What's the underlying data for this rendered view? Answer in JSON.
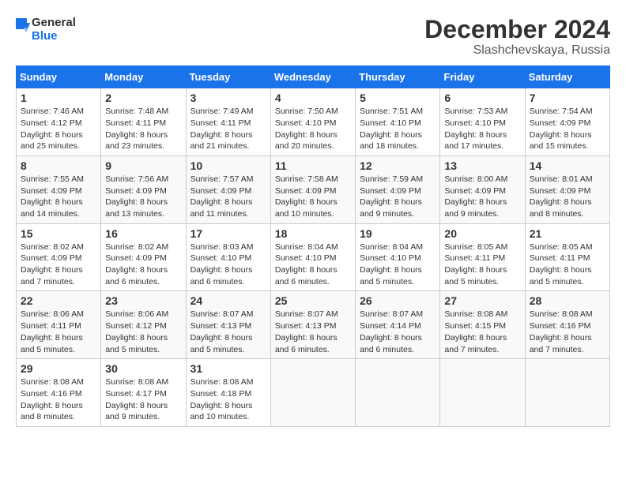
{
  "header": {
    "logo_line1": "General",
    "logo_line2": "Blue",
    "title": "December 2024",
    "subtitle": "Slashchevskaya, Russia"
  },
  "days_of_week": [
    "Sunday",
    "Monday",
    "Tuesday",
    "Wednesday",
    "Thursday",
    "Friday",
    "Saturday"
  ],
  "weeks": [
    [
      {
        "day": "1",
        "info": "Sunrise: 7:46 AM\nSunset: 4:12 PM\nDaylight: 8 hours and 25 minutes."
      },
      {
        "day": "2",
        "info": "Sunrise: 7:48 AM\nSunset: 4:11 PM\nDaylight: 8 hours and 23 minutes."
      },
      {
        "day": "3",
        "info": "Sunrise: 7:49 AM\nSunset: 4:11 PM\nDaylight: 8 hours and 21 minutes."
      },
      {
        "day": "4",
        "info": "Sunrise: 7:50 AM\nSunset: 4:10 PM\nDaylight: 8 hours and 20 minutes."
      },
      {
        "day": "5",
        "info": "Sunrise: 7:51 AM\nSunset: 4:10 PM\nDaylight: 8 hours and 18 minutes."
      },
      {
        "day": "6",
        "info": "Sunrise: 7:53 AM\nSunset: 4:10 PM\nDaylight: 8 hours and 17 minutes."
      },
      {
        "day": "7",
        "info": "Sunrise: 7:54 AM\nSunset: 4:09 PM\nDaylight: 8 hours and 15 minutes."
      }
    ],
    [
      {
        "day": "8",
        "info": "Sunrise: 7:55 AM\nSunset: 4:09 PM\nDaylight: 8 hours and 14 minutes."
      },
      {
        "day": "9",
        "info": "Sunrise: 7:56 AM\nSunset: 4:09 PM\nDaylight: 8 hours and 13 minutes."
      },
      {
        "day": "10",
        "info": "Sunrise: 7:57 AM\nSunset: 4:09 PM\nDaylight: 8 hours and 11 minutes."
      },
      {
        "day": "11",
        "info": "Sunrise: 7:58 AM\nSunset: 4:09 PM\nDaylight: 8 hours and 10 minutes."
      },
      {
        "day": "12",
        "info": "Sunrise: 7:59 AM\nSunset: 4:09 PM\nDaylight: 8 hours and 9 minutes."
      },
      {
        "day": "13",
        "info": "Sunrise: 8:00 AM\nSunset: 4:09 PM\nDaylight: 8 hours and 9 minutes."
      },
      {
        "day": "14",
        "info": "Sunrise: 8:01 AM\nSunset: 4:09 PM\nDaylight: 8 hours and 8 minutes."
      }
    ],
    [
      {
        "day": "15",
        "info": "Sunrise: 8:02 AM\nSunset: 4:09 PM\nDaylight: 8 hours and 7 minutes."
      },
      {
        "day": "16",
        "info": "Sunrise: 8:02 AM\nSunset: 4:09 PM\nDaylight: 8 hours and 6 minutes."
      },
      {
        "day": "17",
        "info": "Sunrise: 8:03 AM\nSunset: 4:10 PM\nDaylight: 8 hours and 6 minutes."
      },
      {
        "day": "18",
        "info": "Sunrise: 8:04 AM\nSunset: 4:10 PM\nDaylight: 8 hours and 6 minutes."
      },
      {
        "day": "19",
        "info": "Sunrise: 8:04 AM\nSunset: 4:10 PM\nDaylight: 8 hours and 5 minutes."
      },
      {
        "day": "20",
        "info": "Sunrise: 8:05 AM\nSunset: 4:11 PM\nDaylight: 8 hours and 5 minutes."
      },
      {
        "day": "21",
        "info": "Sunrise: 8:05 AM\nSunset: 4:11 PM\nDaylight: 8 hours and 5 minutes."
      }
    ],
    [
      {
        "day": "22",
        "info": "Sunrise: 8:06 AM\nSunset: 4:11 PM\nDaylight: 8 hours and 5 minutes."
      },
      {
        "day": "23",
        "info": "Sunrise: 8:06 AM\nSunset: 4:12 PM\nDaylight: 8 hours and 5 minutes."
      },
      {
        "day": "24",
        "info": "Sunrise: 8:07 AM\nSunset: 4:13 PM\nDaylight: 8 hours and 5 minutes."
      },
      {
        "day": "25",
        "info": "Sunrise: 8:07 AM\nSunset: 4:13 PM\nDaylight: 8 hours and 6 minutes."
      },
      {
        "day": "26",
        "info": "Sunrise: 8:07 AM\nSunset: 4:14 PM\nDaylight: 8 hours and 6 minutes."
      },
      {
        "day": "27",
        "info": "Sunrise: 8:08 AM\nSunset: 4:15 PM\nDaylight: 8 hours and 7 minutes."
      },
      {
        "day": "28",
        "info": "Sunrise: 8:08 AM\nSunset: 4:16 PM\nDaylight: 8 hours and 7 minutes."
      }
    ],
    [
      {
        "day": "29",
        "info": "Sunrise: 8:08 AM\nSunset: 4:16 PM\nDaylight: 8 hours and 8 minutes."
      },
      {
        "day": "30",
        "info": "Sunrise: 8:08 AM\nSunset: 4:17 PM\nDaylight: 8 hours and 9 minutes."
      },
      {
        "day": "31",
        "info": "Sunrise: 8:08 AM\nSunset: 4:18 PM\nDaylight: 8 hours and 10 minutes."
      },
      null,
      null,
      null,
      null
    ]
  ]
}
